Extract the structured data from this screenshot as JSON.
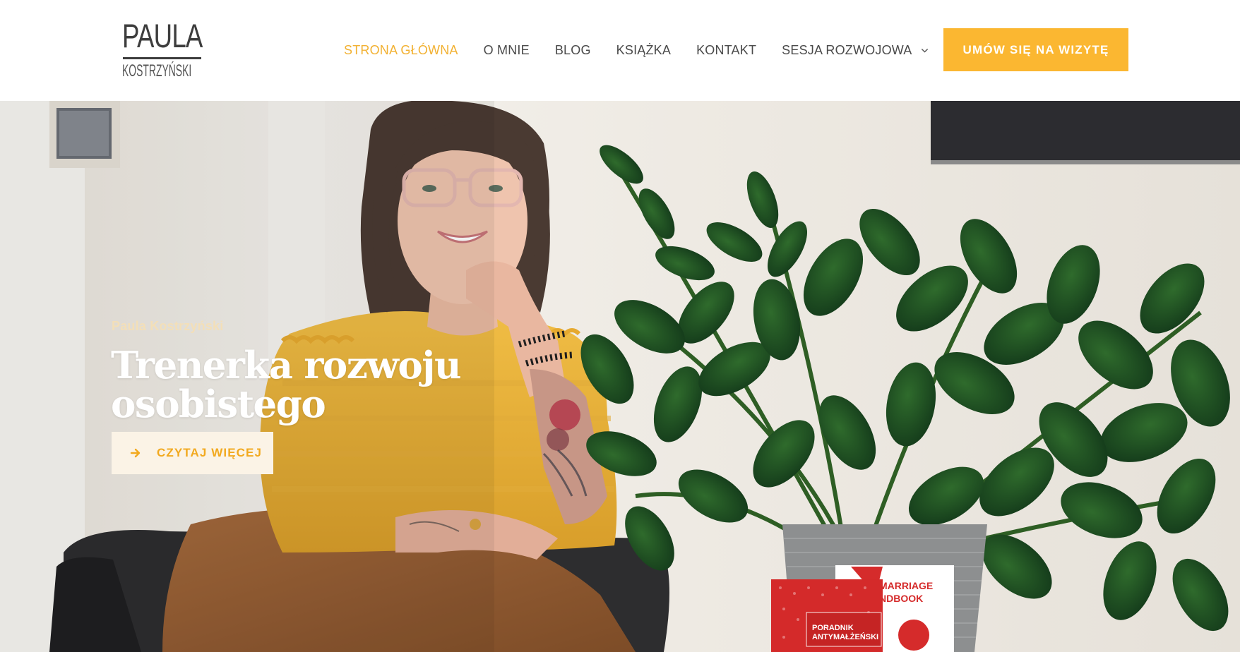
{
  "header": {
    "logo": {
      "top": "PAULA",
      "bottom": "KOSTRZYŃSKI"
    },
    "nav": [
      {
        "label": "STRONA GŁÓWNA",
        "active": true
      },
      {
        "label": "O MNIE"
      },
      {
        "label": "BLOG"
      },
      {
        "label": "KSIĄŻKA"
      },
      {
        "label": "KONTAKT"
      },
      {
        "label": "SESJA ROZWOJOWA",
        "has_dropdown": true,
        "icon": "chevron-down-icon"
      }
    ],
    "cta_label": "UMÓW SIĘ NA WIZYTĘ"
  },
  "hero": {
    "eyebrow": "Paula Kostrzyński",
    "title_line1": "Trenerka rozwoju",
    "title_line2": "osobistego",
    "button_label": "CZYTAJ WIĘCEJ",
    "button_icon": "arrow-right-icon",
    "book_cover_1": "PORADNIK ANTYMAŁŻEŃSKI",
    "book_cover_2": "MARRIAGE\nNDBOOK"
  },
  "colors": {
    "accent": "#fbb731",
    "active_nav": "#f2b132",
    "nav_text": "#4a4a4a",
    "hero_button_bg": "#fbf3e6",
    "hero_button_text": "#f2a91f"
  }
}
